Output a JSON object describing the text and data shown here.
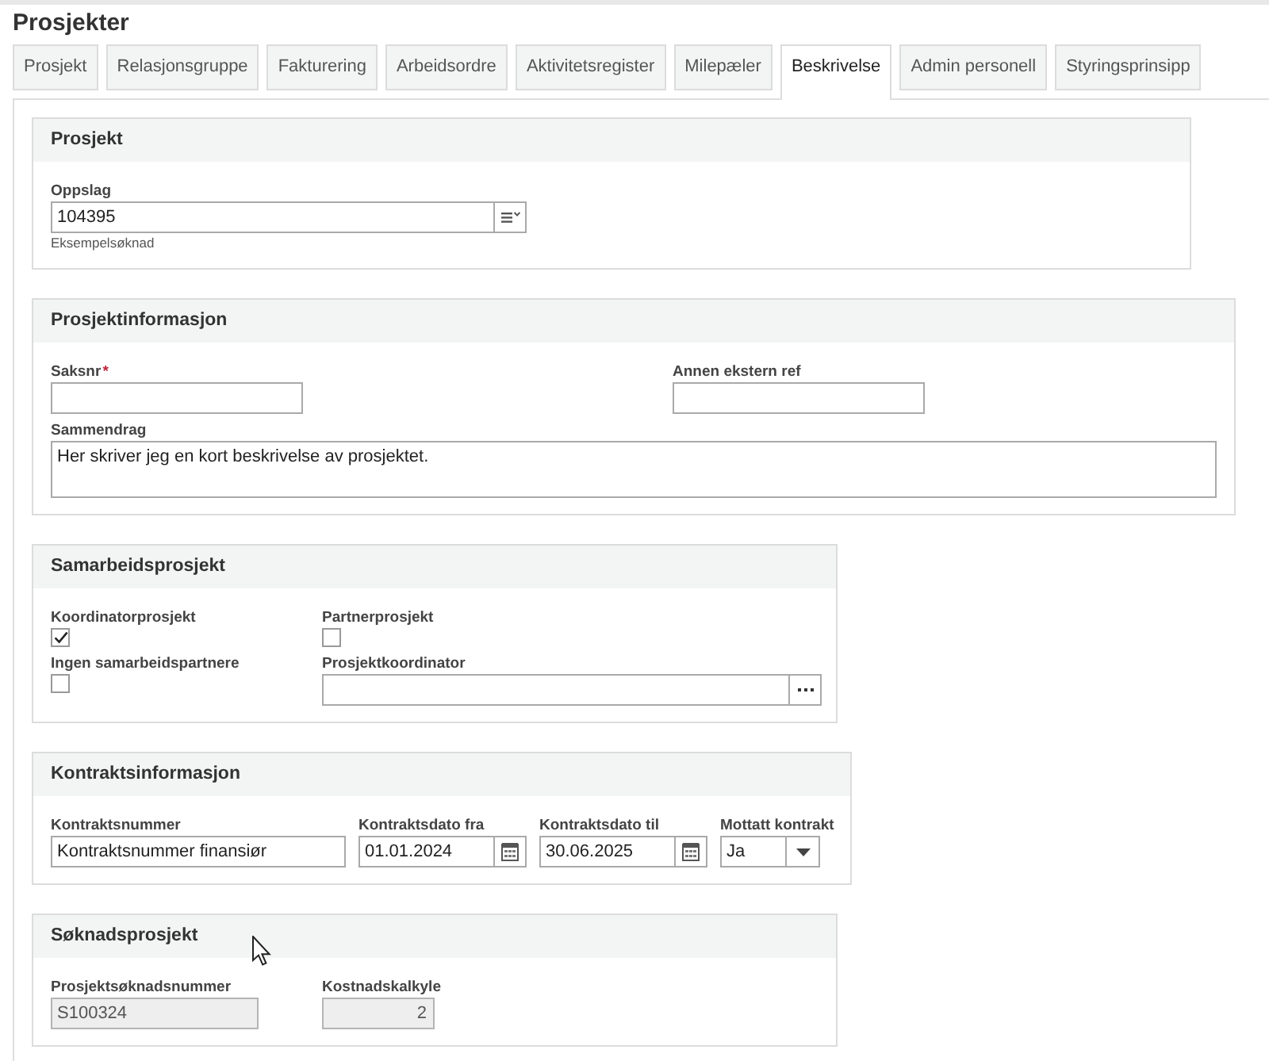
{
  "page": {
    "title": "Prosjekter"
  },
  "tabs": [
    {
      "label": "Prosjekt",
      "selected": false
    },
    {
      "label": "Relasjonsgruppe",
      "selected": false
    },
    {
      "label": "Fakturering",
      "selected": false
    },
    {
      "label": "Arbeidsordre",
      "selected": false
    },
    {
      "label": "Aktivitetsregister",
      "selected": false
    },
    {
      "label": "Milepæler",
      "selected": false
    },
    {
      "label": "Beskrivelse",
      "selected": true
    },
    {
      "label": "Admin personell",
      "selected": false
    },
    {
      "label": "Styringsprinsipp",
      "selected": false
    }
  ],
  "sections": [
    {
      "title": "Prosjekt",
      "fields": [
        {
          "kind": "lookup",
          "label": "Oppslag",
          "value": "104395",
          "caption": "Eksempelsøknad"
        }
      ]
    },
    {
      "title": "Prosjektinformasjon",
      "fields": [
        {
          "kind": "text",
          "label": "Saksnr",
          "required_mark": "*"
        },
        {
          "kind": "text",
          "label": "Annen ekstern ref"
        },
        {
          "kind": "textarea",
          "label": "Sammendrag",
          "value": "Her skriver jeg en kort beskrivelse av prosjektet."
        }
      ]
    },
    {
      "title": "Samarbeidsprosjekt",
      "fields": [
        {
          "kind": "checkbox",
          "label": "Koordinatorprosjekt",
          "checked": true
        },
        {
          "kind": "checkbox",
          "label": "Partnerprosjekt",
          "checked": false
        },
        {
          "kind": "checkbox",
          "label": "Ingen samarbeidspartnere",
          "checked": false
        },
        {
          "kind": "browse",
          "label": "Prosjektkoordinator"
        }
      ]
    },
    {
      "title": "Kontraktsinformasjon",
      "fields": [
        {
          "kind": "text",
          "label": "Kontraktsnummer",
          "value": "Kontraktsnummer finansiør"
        },
        {
          "kind": "date",
          "label": "Kontraktsdato fra",
          "value": "01.01.2024"
        },
        {
          "kind": "date",
          "label": "Kontraktsdato til",
          "value": "30.06.2025"
        },
        {
          "kind": "select",
          "label": "Mottatt kontrakt",
          "value": "Ja"
        }
      ]
    },
    {
      "title": "Søknadsprosjekt",
      "fields": [
        {
          "kind": "text",
          "label": "Prosjektsøknadsnummer",
          "value": "S100324",
          "disabled": true
        },
        {
          "kind": "number",
          "label": "Kostnadskalkyle",
          "value": "2",
          "disabled": true
        }
      ]
    }
  ]
}
